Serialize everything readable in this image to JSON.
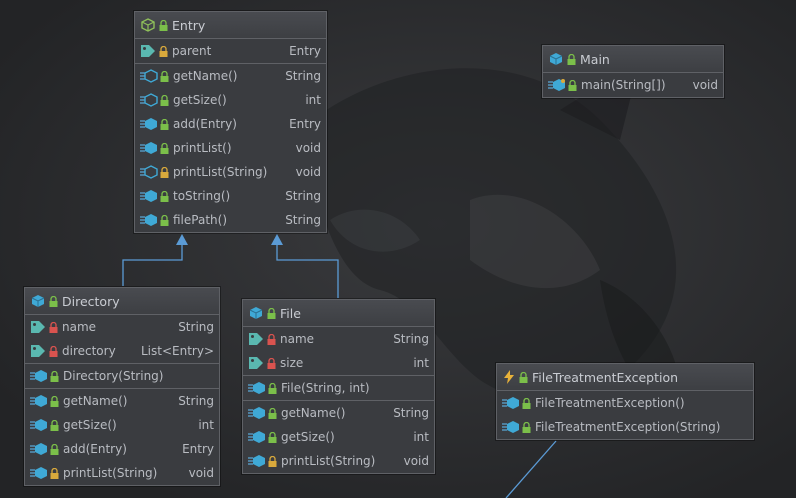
{
  "classes": {
    "entry": {
      "title": "Entry",
      "fields": [
        {
          "name": "parent",
          "type": "Entry"
        }
      ],
      "methods": [
        {
          "name": "getName()",
          "type": "String",
          "kind": "abstract"
        },
        {
          "name": "getSize()",
          "type": "int",
          "kind": "abstract"
        },
        {
          "name": "add(Entry)",
          "type": "Entry",
          "kind": "method"
        },
        {
          "name": "printList()",
          "type": "void",
          "kind": "method"
        },
        {
          "name": "printList(String)",
          "type": "void",
          "kind": "abstract-protected"
        },
        {
          "name": "toString()",
          "type": "String",
          "kind": "method"
        },
        {
          "name": "filePath()",
          "type": "String",
          "kind": "method"
        }
      ]
    },
    "main": {
      "title": "Main",
      "methods": [
        {
          "name": "main(String[])",
          "type": "void"
        }
      ]
    },
    "directory": {
      "title": "Directory",
      "fields": [
        {
          "name": "name",
          "type": "String"
        },
        {
          "name": "directory",
          "type": "List<Entry>"
        }
      ],
      "constructors": [
        {
          "name": "Directory(String)",
          "type": ""
        }
      ],
      "methods": [
        {
          "name": "getName()",
          "type": "String"
        },
        {
          "name": "getSize()",
          "type": "int"
        },
        {
          "name": "add(Entry)",
          "type": "Entry"
        },
        {
          "name": "printList(String)",
          "type": "void"
        }
      ]
    },
    "file": {
      "title": "File",
      "fields": [
        {
          "name": "name",
          "type": "String"
        },
        {
          "name": "size",
          "type": "int"
        }
      ],
      "constructors": [
        {
          "name": "File(String, int)",
          "type": ""
        }
      ],
      "methods": [
        {
          "name": "getName()",
          "type": "String"
        },
        {
          "name": "getSize()",
          "type": "int"
        },
        {
          "name": "printList(String)",
          "type": "void"
        }
      ]
    },
    "exception": {
      "title": "FileTreatmentException",
      "constructors": [
        {
          "name": "FileTreatmentException()",
          "type": ""
        },
        {
          "name": "FileTreatmentException(String)",
          "type": ""
        }
      ]
    }
  },
  "colors": {
    "class_icon": "#3fa9d6",
    "abstract_icon": "#8fbf5a",
    "field_icon": "#5ab8b0",
    "lock_public": "#7bbf4a",
    "lock_private": "#d9534f",
    "lock_protected": "#d9a93c",
    "exception_icon": "#e8b23a",
    "link": "#5b9bd5"
  }
}
